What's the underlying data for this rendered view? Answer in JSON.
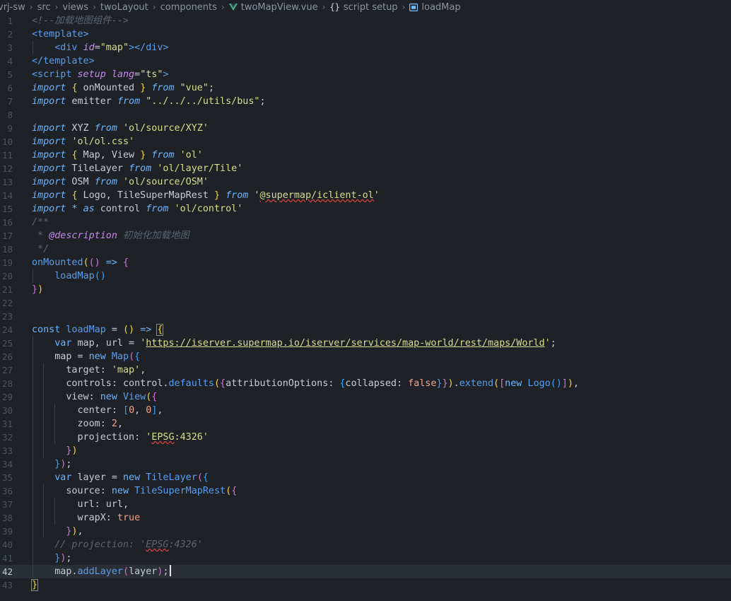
{
  "breadcrumb": {
    "items": [
      "vrj-sw",
      "src",
      "views",
      "twoLayout",
      "components",
      "twoMapView.vue",
      "script setup",
      "loadMap"
    ],
    "braces_glyph": "{}"
  },
  "editor": {
    "active_line": 42,
    "lines": [
      {
        "n": "1",
        "tokens": [
          [
            "c",
            "<!--加载地图组件-->"
          ]
        ]
      },
      {
        "n": "2",
        "tokens": [
          [
            "t",
            "<template>"
          ]
        ]
      },
      {
        "n": "3",
        "tokens": [
          [
            "op",
            "    "
          ],
          [
            "t",
            "<div "
          ],
          [
            "a",
            "id"
          ],
          [
            "op",
            "="
          ],
          [
            "s",
            "\"map\""
          ],
          [
            "t",
            "></div>"
          ]
        ]
      },
      {
        "n": "4",
        "tokens": [
          [
            "t",
            "</template>"
          ]
        ]
      },
      {
        "n": "5",
        "tokens": [
          [
            "t",
            "<script "
          ],
          [
            "a",
            "setup "
          ],
          [
            "a",
            "lang"
          ],
          [
            "op",
            "="
          ],
          [
            "s",
            "\"ts\""
          ],
          [
            "t",
            ">"
          ]
        ]
      },
      {
        "n": "6",
        "tokens": [
          [
            "ki",
            "import"
          ],
          [
            "op",
            " "
          ],
          [
            "y",
            "{"
          ],
          [
            "op",
            " onMounted "
          ],
          [
            "y",
            "}"
          ],
          [
            "op",
            " "
          ],
          [
            "ki",
            "from"
          ],
          [
            "op",
            " "
          ],
          [
            "s",
            "\"vue\""
          ],
          [
            "op",
            ";"
          ]
        ]
      },
      {
        "n": "7",
        "tokens": [
          [
            "ki",
            "import"
          ],
          [
            "op",
            " emitter "
          ],
          [
            "ki",
            "from"
          ],
          [
            "op",
            " "
          ],
          [
            "s",
            "\"../../../utils/bus\""
          ],
          [
            "op",
            ";"
          ]
        ]
      },
      {
        "n": "8",
        "tokens": []
      },
      {
        "n": "9",
        "tokens": [
          [
            "ki",
            "import"
          ],
          [
            "op",
            " XYZ "
          ],
          [
            "ki",
            "from"
          ],
          [
            "op",
            " "
          ],
          [
            "s",
            "'ol/source/XYZ'"
          ]
        ]
      },
      {
        "n": "10",
        "tokens": [
          [
            "ki",
            "import"
          ],
          [
            "op",
            " "
          ],
          [
            "s",
            "'ol/ol.css'"
          ]
        ]
      },
      {
        "n": "11",
        "tokens": [
          [
            "ki",
            "import"
          ],
          [
            "op",
            " "
          ],
          [
            "y",
            "{"
          ],
          [
            "op",
            " Map, View "
          ],
          [
            "y",
            "}"
          ],
          [
            "op",
            " "
          ],
          [
            "ki",
            "from"
          ],
          [
            "op",
            " "
          ],
          [
            "s",
            "'ol'"
          ]
        ]
      },
      {
        "n": "12",
        "tokens": [
          [
            "ki",
            "import"
          ],
          [
            "op",
            " TileLayer "
          ],
          [
            "ki",
            "from"
          ],
          [
            "op",
            " "
          ],
          [
            "s",
            "'ol/layer/Tile'"
          ]
        ]
      },
      {
        "n": "13",
        "tokens": [
          [
            "ki",
            "import"
          ],
          [
            "op",
            " OSM "
          ],
          [
            "ki",
            "from"
          ],
          [
            "op",
            " "
          ],
          [
            "s",
            "'ol/source/OSM'"
          ]
        ]
      },
      {
        "n": "14",
        "tokens": [
          [
            "ki",
            "import"
          ],
          [
            "op",
            " "
          ],
          [
            "y",
            "{"
          ],
          [
            "op",
            " Logo, TileSuperMapRest "
          ],
          [
            "y",
            "}"
          ],
          [
            "op",
            " "
          ],
          [
            "ki",
            "from"
          ],
          [
            "op",
            " "
          ],
          [
            "s",
            "'"
          ],
          [
            "sw",
            "@supermap/iclient-ol"
          ],
          [
            "s",
            "'"
          ]
        ]
      },
      {
        "n": "15",
        "tokens": [
          [
            "ki",
            "import"
          ],
          [
            "op",
            " "
          ],
          [
            "k",
            "*"
          ],
          [
            "op",
            " "
          ],
          [
            "ki",
            "as"
          ],
          [
            "op",
            " control "
          ],
          [
            "ki",
            "from"
          ],
          [
            "op",
            " "
          ],
          [
            "s",
            "'ol/control'"
          ]
        ]
      },
      {
        "n": "16",
        "tokens": [
          [
            "c",
            "/**"
          ]
        ]
      },
      {
        "n": "17",
        "tokens": [
          [
            "c",
            " * "
          ],
          [
            "a",
            "@description"
          ],
          [
            "c",
            " 初始化加载地图"
          ]
        ]
      },
      {
        "n": "18",
        "tokens": [
          [
            "c",
            " */"
          ]
        ]
      },
      {
        "n": "19",
        "tokens": [
          [
            "f",
            "onMounted"
          ],
          [
            "y",
            "("
          ],
          [
            "p",
            "()"
          ],
          [
            "op",
            " "
          ],
          [
            "k",
            "=>"
          ],
          [
            "op",
            " "
          ],
          [
            "p",
            "{"
          ]
        ]
      },
      {
        "n": "20",
        "tokens": [
          [
            "op",
            "    "
          ],
          [
            "f",
            "loadMap"
          ],
          [
            "b",
            "()"
          ]
        ]
      },
      {
        "n": "21",
        "tokens": [
          [
            "p",
            "}"
          ],
          [
            "y",
            ")"
          ]
        ]
      },
      {
        "n": "22",
        "tokens": []
      },
      {
        "n": "23",
        "tokens": []
      },
      {
        "n": "24",
        "tokens": [
          [
            "k",
            "const"
          ],
          [
            "op",
            " "
          ],
          [
            "f",
            "loadMap"
          ],
          [
            "op",
            " = "
          ],
          [
            "y",
            "()"
          ],
          [
            "op",
            " "
          ],
          [
            "k",
            "=>"
          ],
          [
            "op",
            " "
          ],
          [
            "yb",
            "{"
          ]
        ]
      },
      {
        "n": "25",
        "tokens": [
          [
            "op",
            "    "
          ],
          [
            "k",
            "var"
          ],
          [
            "op",
            " map, url = "
          ],
          [
            "s",
            "'"
          ],
          [
            "u",
            "https://iserver.supermap.io/iserver/services/map-world/rest/maps/World"
          ],
          [
            "s",
            "'"
          ],
          [
            "op",
            ";"
          ]
        ]
      },
      {
        "n": "26",
        "tokens": [
          [
            "op",
            "    map = "
          ],
          [
            "k",
            "new"
          ],
          [
            "op",
            " "
          ],
          [
            "f",
            "Map"
          ],
          [
            "p",
            "("
          ],
          [
            "b",
            "{"
          ]
        ]
      },
      {
        "n": "27",
        "tokens": [
          [
            "op",
            "      target: "
          ],
          [
            "s",
            "'map'"
          ],
          [
            "op",
            ","
          ]
        ]
      },
      {
        "n": "28",
        "tokens": [
          [
            "op",
            "      controls: control."
          ],
          [
            "f",
            "defaults"
          ],
          [
            "y",
            "("
          ],
          [
            "p",
            "{"
          ],
          [
            "op",
            "attributionOptions: "
          ],
          [
            "b",
            "{"
          ],
          [
            "op",
            "collapsed: "
          ],
          [
            "n",
            "false"
          ],
          [
            "b",
            "}"
          ],
          [
            "p",
            "}"
          ],
          [
            "y",
            ")"
          ],
          [
            "op",
            "."
          ],
          [
            "f",
            "extend"
          ],
          [
            "y",
            "("
          ],
          [
            "p",
            "["
          ],
          [
            "k",
            "new"
          ],
          [
            "op",
            " "
          ],
          [
            "f",
            "Logo"
          ],
          [
            "b",
            "()"
          ],
          [
            "p",
            "]"
          ],
          [
            "y",
            ")"
          ],
          [
            "op",
            ","
          ]
        ]
      },
      {
        "n": "29",
        "tokens": [
          [
            "op",
            "      view: "
          ],
          [
            "k",
            "new"
          ],
          [
            "op",
            " "
          ],
          [
            "f",
            "View"
          ],
          [
            "y",
            "("
          ],
          [
            "p",
            "{"
          ]
        ]
      },
      {
        "n": "30",
        "tokens": [
          [
            "op",
            "        center: "
          ],
          [
            "b",
            "["
          ],
          [
            "n",
            "0"
          ],
          [
            "op",
            ", "
          ],
          [
            "n",
            "0"
          ],
          [
            "b",
            "]"
          ],
          [
            "op",
            ","
          ]
        ]
      },
      {
        "n": "31",
        "tokens": [
          [
            "op",
            "        zoom: "
          ],
          [
            "n",
            "2"
          ],
          [
            "op",
            ","
          ]
        ]
      },
      {
        "n": "32",
        "tokens": [
          [
            "op",
            "        projection: "
          ],
          [
            "s",
            "'"
          ],
          [
            "sw",
            "EPSG"
          ],
          [
            "s",
            ":4326'"
          ]
        ]
      },
      {
        "n": "33",
        "tokens": [
          [
            "op",
            "      "
          ],
          [
            "p",
            "}"
          ],
          [
            "y",
            ")"
          ]
        ]
      },
      {
        "n": "34",
        "tokens": [
          [
            "op",
            "    "
          ],
          [
            "b",
            "}"
          ],
          [
            "p",
            ")"
          ],
          [
            "op",
            ";"
          ]
        ]
      },
      {
        "n": "35",
        "tokens": [
          [
            "op",
            "    "
          ],
          [
            "k",
            "var"
          ],
          [
            "op",
            " layer = "
          ],
          [
            "k",
            "new"
          ],
          [
            "op",
            " "
          ],
          [
            "f",
            "TileLayer"
          ],
          [
            "p",
            "("
          ],
          [
            "b",
            "{"
          ]
        ]
      },
      {
        "n": "36",
        "tokens": [
          [
            "op",
            "      source: "
          ],
          [
            "k",
            "new"
          ],
          [
            "op",
            " "
          ],
          [
            "f",
            "TileSuperMapRest"
          ],
          [
            "y",
            "("
          ],
          [
            "p",
            "{"
          ]
        ]
      },
      {
        "n": "37",
        "tokens": [
          [
            "op",
            "        url: url,"
          ]
        ]
      },
      {
        "n": "38",
        "tokens": [
          [
            "op",
            "        wrapX: "
          ],
          [
            "n",
            "true"
          ]
        ]
      },
      {
        "n": "39",
        "tokens": [
          [
            "op",
            "      "
          ],
          [
            "p",
            "}"
          ],
          [
            "y",
            ")"
          ],
          [
            "op",
            ","
          ]
        ]
      },
      {
        "n": "40",
        "tokens": [
          [
            "op",
            "    "
          ],
          [
            "c",
            "// projection: '"
          ],
          [
            "cw",
            "EPSG"
          ],
          [
            "c",
            ":4326'"
          ]
        ]
      },
      {
        "n": "41",
        "tokens": [
          [
            "op",
            "    "
          ],
          [
            "b",
            "}"
          ],
          [
            "p",
            ")"
          ],
          [
            "op",
            ";"
          ]
        ]
      },
      {
        "n": "42",
        "tokens": [
          [
            "op",
            "    map."
          ],
          [
            "f",
            "addLayer"
          ],
          [
            "p",
            "("
          ],
          [
            "op",
            "layer"
          ],
          [
            "p",
            ")"
          ],
          [
            "op",
            ";"
          ]
        ]
      },
      {
        "n": "43",
        "tokens": [
          [
            "yb",
            "}"
          ]
        ]
      }
    ],
    "guides": {
      "3": [
        1
      ],
      "20": [
        1
      ],
      "25": [
        1
      ],
      "26": [
        1
      ],
      "27": [
        1,
        2
      ],
      "28": [
        1,
        2
      ],
      "29": [
        1,
        2
      ],
      "30": [
        1,
        2,
        3
      ],
      "31": [
        1,
        2,
        3
      ],
      "32": [
        1,
        2,
        3
      ],
      "33": [
        1,
        2
      ],
      "34": [
        1
      ],
      "35": [
        1
      ],
      "36": [
        1,
        2
      ],
      "37": [
        1,
        2,
        3
      ],
      "38": [
        1,
        2,
        3
      ],
      "39": [
        1,
        2
      ],
      "40": [
        1
      ],
      "41": [
        1
      ],
      "42": [
        1
      ]
    }
  }
}
